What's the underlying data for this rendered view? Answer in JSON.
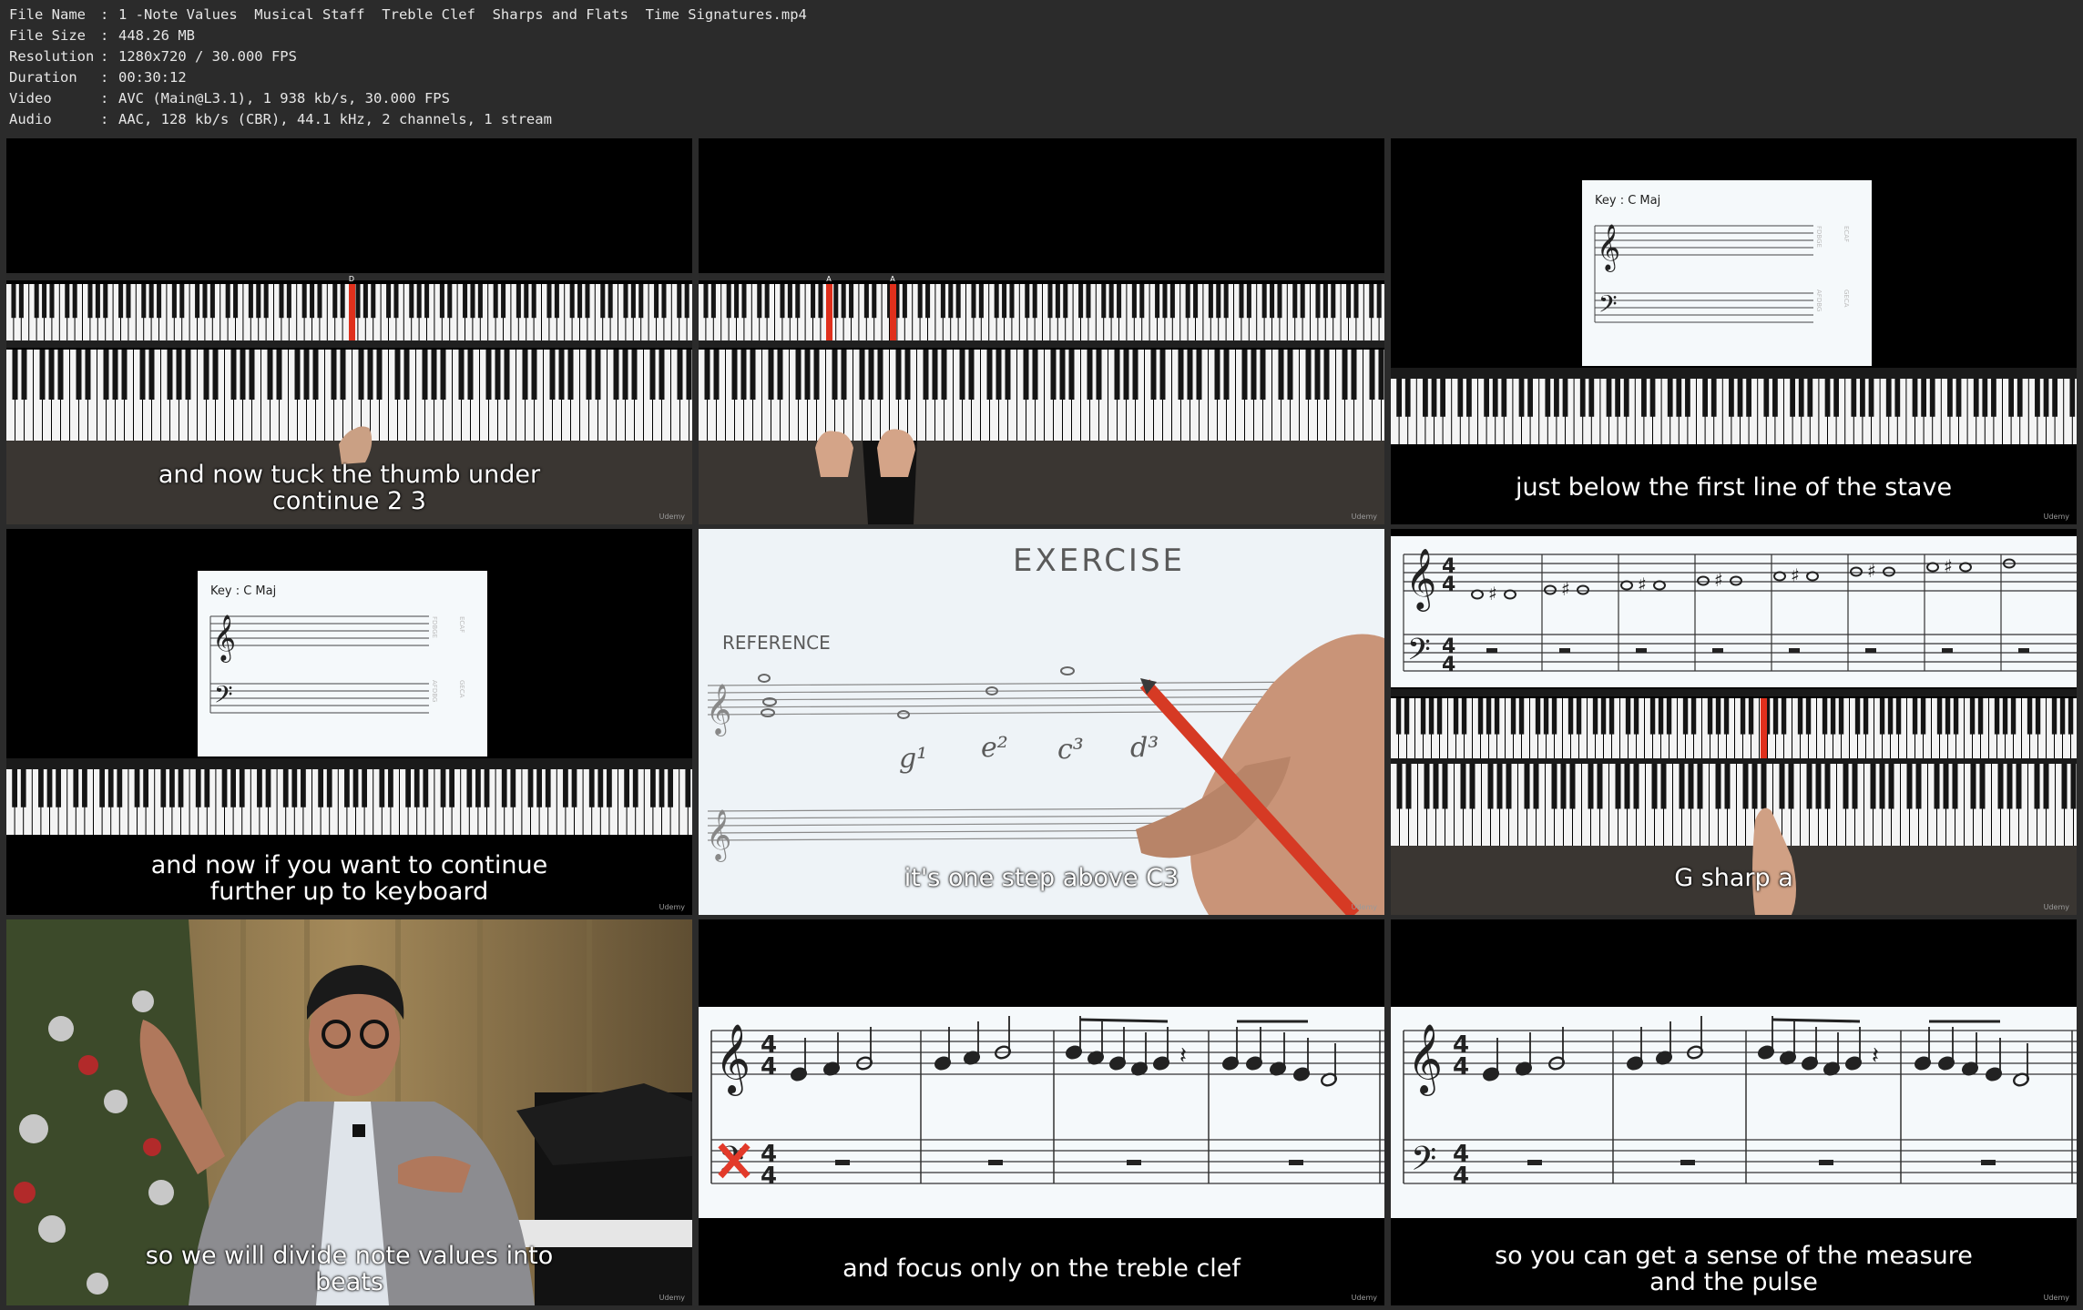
{
  "info": [
    {
      "key": "File Name",
      "value": "1 -Note Values  Musical Staff  Treble Clef  Sharps and Flats  Time Signatures.mp4"
    },
    {
      "key": "File Size",
      "value": "448.26 MB"
    },
    {
      "key": "Resolution",
      "value": "1280x720 / 30.000 FPS"
    },
    {
      "key": "Duration",
      "value": "00:30:12"
    },
    {
      "key": "Video",
      "value": "AVC (Main@L3.1), 1 938 kb/s, 30.000 FPS"
    },
    {
      "key": "Audio",
      "value": "AAC, 128 kb/s (CBR), 44.1 kHz, 2 channels, 1 stream"
    }
  ],
  "watermark": "Udemy",
  "frames": [
    {
      "subtitle_1": "and now tuck the thumb under",
      "subtitle_2": "continue 2 3",
      "key_label": "D"
    },
    {
      "subtitle_1": "",
      "subtitle_2": "",
      "key_label_1": "A",
      "key_label_2": "A"
    },
    {
      "subtitle_1": "just below the first line of the stave",
      "key_text": "Key : C    Maj",
      "side_treble": "FDBGE",
      "side_treble_2": "ECAF",
      "side_bass": "AFDBG",
      "side_bass_2": "GECA"
    },
    {
      "subtitle_1": "and now if you want to continue",
      "subtitle_2": "further up to keyboard",
      "key_text": "Key : C    Maj",
      "side_treble": "FDBGE",
      "side_treble_2": "ECAF",
      "side_bass": "AFDBG",
      "side_bass_2": "GECA"
    },
    {
      "subtitle_1": "it's one step above C3",
      "title": "EXERCISE",
      "reference": "REFERENCE",
      "labels": [
        "g¹",
        "e²",
        "c³",
        "d³"
      ]
    },
    {
      "subtitle_1": "G sharp a"
    },
    {
      "subtitle_1": "so we will divide note values into",
      "subtitle_2": "beats"
    },
    {
      "subtitle_1": "and focus only on the treble clef"
    },
    {
      "subtitle_1": "so you can get a sense of the measure",
      "subtitle_2": "and the pulse"
    }
  ]
}
